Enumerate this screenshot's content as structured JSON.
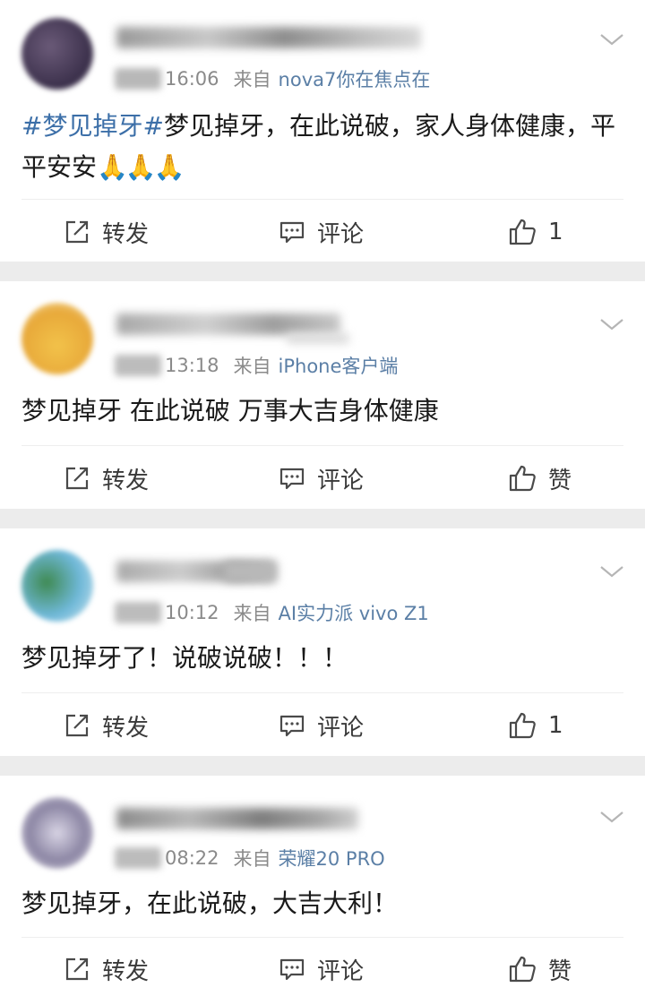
{
  "posts": [
    {
      "time": "16:06",
      "from_label": "来自",
      "device": "nova7你在焦点在",
      "topic": "#梦见掉牙#",
      "text": "梦见掉牙，在此说破，家人身体健康，平平安安",
      "emoji": "🙏🙏🙏",
      "repost_label": "转发",
      "comment_label": "评论",
      "like_label": "1"
    },
    {
      "time": "13:18",
      "from_label": "来自",
      "device": "iPhone客户端",
      "topic": "",
      "text": "梦见掉牙 在此说破 万事大吉身体健康",
      "emoji": "",
      "repost_label": "转发",
      "comment_label": "评论",
      "like_label": "赞"
    },
    {
      "time": "10:12",
      "from_label": "来自",
      "device": "AI实力派 vivo Z1",
      "topic": "",
      "text": "梦见掉牙了！说破说破！！！",
      "emoji": "",
      "repost_label": "转发",
      "comment_label": "评论",
      "like_label": "1"
    },
    {
      "time": "08:22",
      "from_label": "来自",
      "device": "荣耀20 PRO",
      "topic": "",
      "text": "梦见掉牙，在此说破，大吉大利！",
      "emoji": "",
      "repost_label": "转发",
      "comment_label": "评论",
      "like_label": "赞"
    }
  ],
  "icons": {
    "repost": "repost-icon",
    "comment": "comment-icon",
    "like": "thumbs-up-icon",
    "more": "chevron-down-icon"
  },
  "colors": {
    "topic_link": "#3c6fa8",
    "device_link": "#5b7fa6",
    "meta_gray": "#8a8a8a",
    "divider": "#ececec"
  }
}
